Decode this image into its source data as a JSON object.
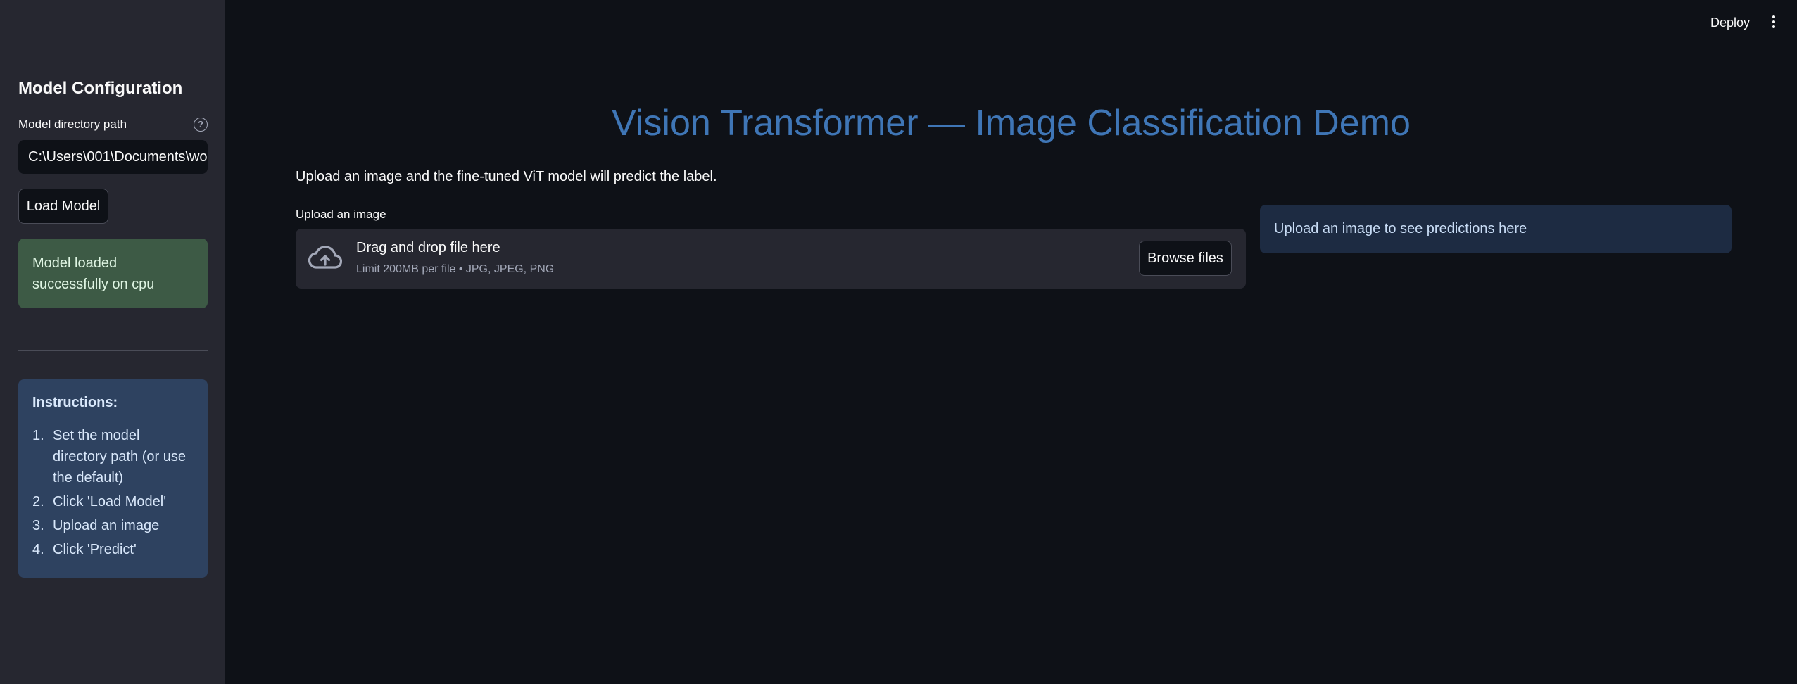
{
  "header": {
    "deploy_label": "Deploy",
    "menu_icon": "kebab-menu-icon"
  },
  "sidebar": {
    "title": "Model Configuration",
    "model_dir_label": "Model directory path",
    "help_icon": "help-circle-icon",
    "model_dir_value": "C:\\Users\\001\\Documents\\wo",
    "load_button_label": "Load Model",
    "success_message": "Model loaded successfully on cpu",
    "instructions_title": "Instructions:",
    "instructions": [
      {
        "num": "1.",
        "text": "Set the model directory path (or use the default)"
      },
      {
        "num": "2.",
        "text": "Click 'Load Model'"
      },
      {
        "num": "3.",
        "text": "Upload an image"
      },
      {
        "num": "4.",
        "text": "Click 'Predict'"
      }
    ]
  },
  "main": {
    "title": "Vision Transformer — Image Classification Demo",
    "subtitle": "Upload an image and the fine-tuned ViT model will predict the label.",
    "upload_label": "Upload an image",
    "dropzone_text": "Drag and drop file here",
    "dropzone_limit": "Limit 200MB per file • JPG, JPEG, PNG",
    "upload_icon": "cloud-upload-icon",
    "browse_button_label": "Browse files",
    "prediction_placeholder": "Upload an image to see predictions here"
  },
  "colors": {
    "background": "#0e1117",
    "sidebar": "#262730",
    "title_accent": "#3f76b6",
    "success_bg": "#3d5a45",
    "info_bg": "#2e4260"
  }
}
